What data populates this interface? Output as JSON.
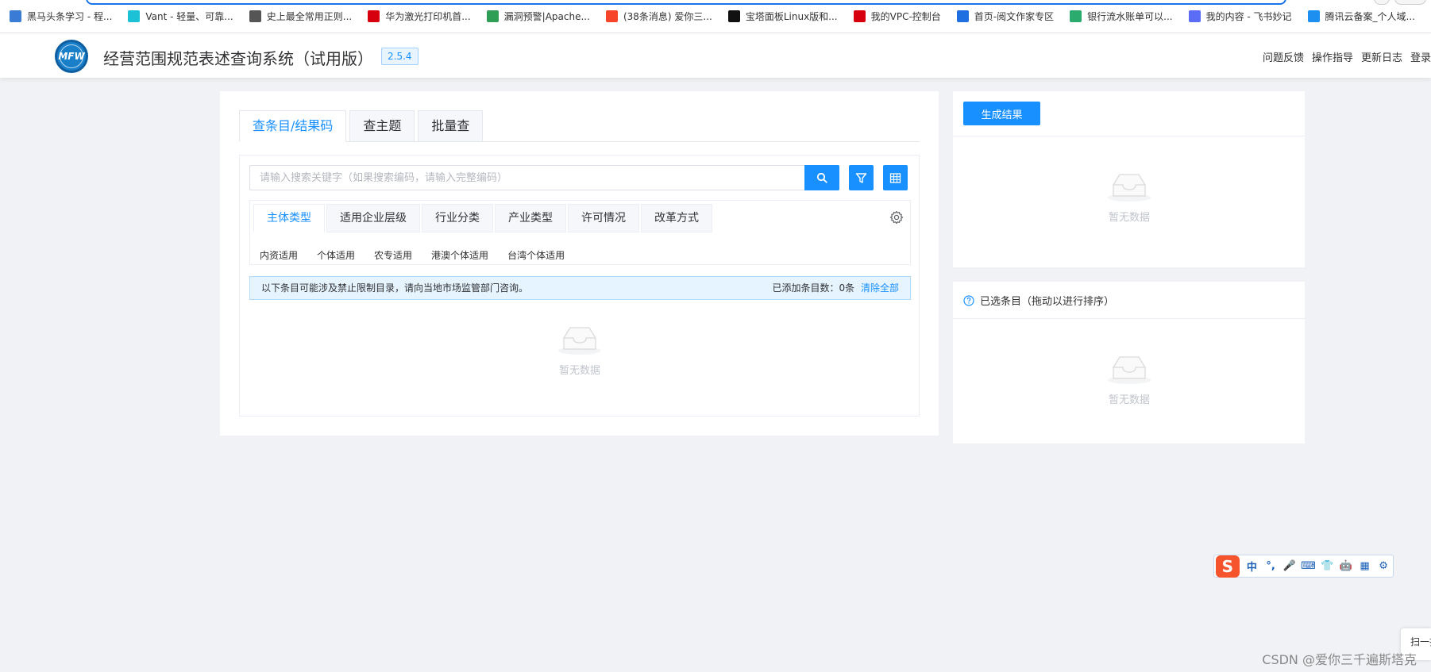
{
  "bookmarks": [
    {
      "label": "黑马头条学习 - 程...",
      "color": "#3a7bd5"
    },
    {
      "label": "Vant - 轻量、可靠...",
      "color": "#1dc1d6"
    },
    {
      "label": "史上最全常用正则...",
      "color": "#555555"
    },
    {
      "label": "华为激光打印机首...",
      "color": "#d7000f"
    },
    {
      "label": "漏洞预警|Apache...",
      "color": "#2e9e57"
    },
    {
      "label": "(38条消息) 爱你三...",
      "color": "#f7452b"
    },
    {
      "label": "宝塔面板Linux版和...",
      "color": "#111111"
    },
    {
      "label": "我的VPC-控制台",
      "color": "#d7000f"
    },
    {
      "label": "首页-阅文作家专区",
      "color": "#1f6fe0"
    },
    {
      "label": "银行流水账单可以...",
      "color": "#2bab6e"
    },
    {
      "label": "我的内容 - 飞书妙记",
      "color": "#5b6cf7"
    },
    {
      "label": "腾讯云备案_个人域...",
      "color": "#1c8ff1"
    }
  ],
  "header": {
    "logo_text": "MFW",
    "title": "经营范围规范表述查询系统（试用版）",
    "version": "2.5.4",
    "links": [
      "问题反馈",
      "操作指导",
      "更新日志",
      "登录"
    ]
  },
  "main": {
    "tabs": [
      "查条目/结果码",
      "查主题",
      "批量查"
    ],
    "search_placeholder": "请输入搜索关键字（如果搜索编码，请输入完整编码）",
    "filter_tabs": [
      "主体类型",
      "适用企业层级",
      "行业分类",
      "产业类型",
      "许可情况",
      "改革方式"
    ],
    "options": [
      "内资适用",
      "个体适用",
      "农专适用",
      "港澳个体适用",
      "台湾个体适用"
    ],
    "notice": "以下条目可能涉及禁止限制目录，请向当地市场监管部门咨询。",
    "added_count_label": "已添加条目数：0条",
    "clear_all": "清除全部",
    "empty_text": "暂无数据"
  },
  "right": {
    "generate_button": "生成结果",
    "empty_text": "暂无数据",
    "selected_title": "已选条目（拖动以进行排序）",
    "selected_empty": "暂无数据"
  },
  "ime": {
    "logo": "S",
    "keys": [
      "中",
      "°,",
      "🎤",
      "⌨",
      "👕",
      "🤖",
      "▦",
      "⚙"
    ]
  },
  "watermark": "CSDN @爱你三千遍斯塔克",
  "side_scan": "扫一扫",
  "colors": {
    "primary": "#1890ff",
    "background": "#f0f2f5"
  }
}
